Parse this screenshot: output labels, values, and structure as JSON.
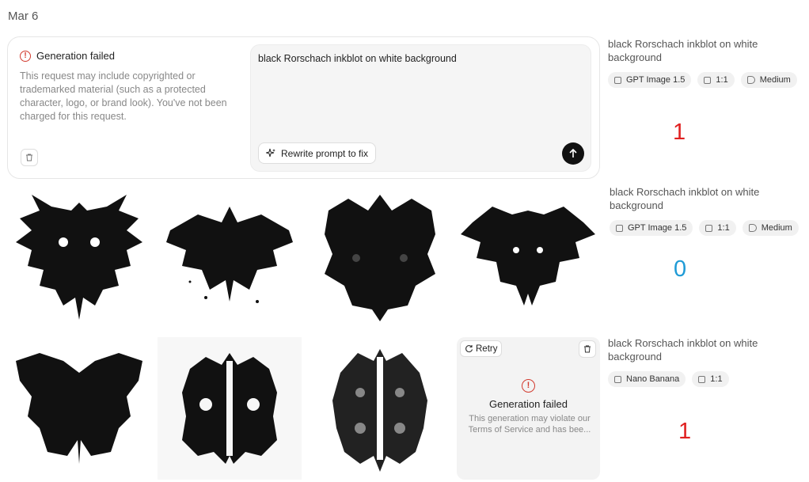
{
  "date": "Mar 6",
  "failed_request": {
    "title": "Generation failed",
    "message": "This request may include copyrighted or trademarked material (such as a protected character, logo, or brand look). You've not been charged for this request.",
    "prompt": "black Rorschach inkblot on white background",
    "rewrite_label": "Rewrite prompt to fix"
  },
  "groups": [
    {
      "prompt": "black Rorschach inkblot on white background",
      "chips": [
        {
          "icon": "image-icon",
          "label": "GPT Image 1.5"
        },
        {
          "icon": "square-icon",
          "label": "1:1"
        },
        {
          "icon": "tag-icon",
          "label": "Medium"
        }
      ],
      "counter": "1",
      "counter_color": "#e02020"
    },
    {
      "prompt": "black Rorschach inkblot on white background",
      "chips": [
        {
          "icon": "image-icon",
          "label": "GPT Image 1.5"
        },
        {
          "icon": "square-icon",
          "label": "1:1"
        },
        {
          "icon": "tag-icon",
          "label": "Medium"
        }
      ],
      "counter": "0",
      "counter_color": "#1f9bd6"
    },
    {
      "prompt": "black Rorschach inkblot on white background",
      "chips": [
        {
          "icon": "image-icon",
          "label": "Nano Banana"
        },
        {
          "icon": "square-icon",
          "label": "1:1"
        }
      ],
      "counter": "1",
      "counter_color": "#e02020"
    }
  ],
  "failed_tile": {
    "retry_label": "Retry",
    "title": "Generation failed",
    "message": "This generation may violate our Terms of Service and has bee..."
  }
}
